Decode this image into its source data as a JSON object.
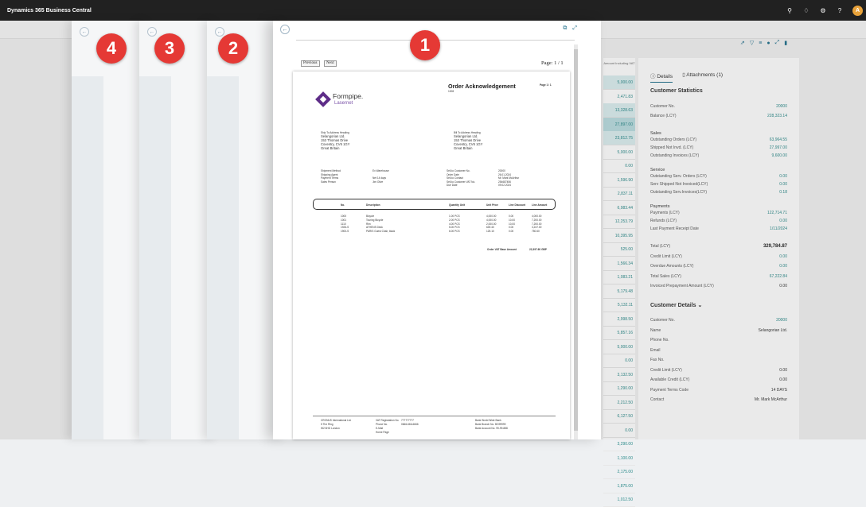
{
  "app": {
    "title": "Dynamics 365 Business Central",
    "avatar": "A"
  },
  "topbar": {
    "icons": [
      "search-icon",
      "bell-icon",
      "gear-icon",
      "help-icon"
    ],
    "icon_glyphs": [
      "⚲",
      "♢",
      "⚙",
      "?"
    ]
  },
  "stack": [
    {
      "num": "4"
    },
    {
      "num": "3"
    },
    {
      "num": "2"
    }
  ],
  "card": {
    "num": "1",
    "nav": {
      "previous": "Previous",
      "next": "Next",
      "page": "Page: 1 / 1"
    },
    "doc": {
      "title": "Order Acknowledgement",
      "number": "1008",
      "page": "Page 1 / 1",
      "logo_name": "Formpipe.",
      "logo_sub": "Lasernet",
      "ship_heading": "Ship To Address Heading",
      "ship_lines": [
        "Selangorian Ltd.",
        "153 Thomas Drive",
        "Coventry, CV6 1GY",
        "Great Britain"
      ],
      "bill_heading": "Bill To Address Heading",
      "bill_lines": [
        "Selangorian Ltd.",
        "153 Thomas Drive",
        "Coventry, CV6 1GY",
        "Great Britain"
      ],
      "left_info": [
        {
          "k": "Shipment Method",
          "v": "Ex Warehouse"
        },
        {
          "k": "Shipping Agent",
          "v": ""
        },
        {
          "k": "Payment Terms",
          "v": "Net 14 days"
        },
        {
          "k": "Sales Person",
          "v": "Jim Olive"
        }
      ],
      "right_info": [
        {
          "k": "Sell-to Customer No.",
          "v": "20000"
        },
        {
          "k": "Order Date",
          "v": "26.01.2024"
        },
        {
          "k": "Sell-to Contact",
          "v": "Mr. Mark McArthur"
        },
        {
          "k": "Sell-to Customer VAT No.",
          "v": "254687456"
        },
        {
          "k": "Due Date",
          "v": "09.02.2024"
        }
      ],
      "cols": [
        "No.",
        "Description",
        "Quantity Unit",
        "Unit Price",
        "Line Discount",
        "Line Amount"
      ],
      "rows": [
        [
          "1000",
          "Bicycle",
          "1.00 PCS",
          "4,000.00",
          "0.00",
          "4,000.00"
        ],
        [
          "1001",
          "Touring Bicycle",
          "2.00 PCS",
          "4,000.00",
          "10.00",
          "7,200.00"
        ],
        [
          "1110",
          "Rim",
          "4.00 PCS",
          "2,000.00",
          "10.00",
          "7,200.00"
        ],
        [
          "1926-S",
          "ATHENS Desk",
          "5.00 PCS",
          "649.40",
          "0.00",
          "3,247.00"
        ],
        [
          "1900-S",
          "PARIS Guest Chair, black",
          "6.00 PCS",
          "125.10",
          "0.00",
          "750.60"
        ]
      ],
      "total_label": "Order VAT Base Amount",
      "total_value": "22,397.60 GBP",
      "footer": {
        "company": [
          "CRONUS International Ltd.",
          "5 The Ring",
          "W2 8HG London"
        ],
        "contact_labels": [
          "VAT Registration No.",
          "Phone No.",
          "E-Mail",
          "Home Page"
        ],
        "contact_values": [
          "777777777",
          "0666-666-6666",
          "",
          ""
        ],
        "bank": [
          "Bank World Wide Bank",
          "Bank Branch No. BG99999",
          "Bank Account No. 99-99-888"
        ]
      }
    }
  },
  "list": {
    "header": "Amount Including VAT",
    "values": [
      "5,000.00",
      "2,471.83",
      "13,328.63",
      "27,897.00",
      "23,812.75",
      "5,000.00",
      "0.00",
      "1,596.90",
      "2,837.11",
      "6,983.44",
      "12,253.79",
      "10,395.95",
      "525.00",
      "1,566.34",
      "1,083.21",
      "5,179.48",
      "5,132.11",
      "2,998.50",
      "5,857.16",
      "5,000.00",
      "0.00",
      "3,132.50",
      "1,290.00",
      "2,212.50",
      "6,127.50",
      "0.00",
      "3,290.00",
      "1,100.00",
      "2,175.00",
      "1,875.00",
      "1,012.50"
    ]
  },
  "factbox": {
    "tabs": [
      "Details",
      "Attachments (1)"
    ],
    "tab_icons": [
      "info-icon",
      "paperclip-icon"
    ],
    "tools": [
      "share-icon",
      "filter-icon",
      "list-icon",
      "info-icon",
      "expand-icon",
      "bookmark-icon"
    ],
    "stats_heading": "Customer Statistics",
    "block1": [
      {
        "k": "Customer No.",
        "v": "20000"
      },
      {
        "k": "Balance (LCY)",
        "v": "228,323.14"
      }
    ],
    "sales_heading": "Sales",
    "sales": [
      {
        "k": "Outstanding Orders (LCY)",
        "v": "63,964.55"
      },
      {
        "k": "Shipped Not Invd. (LCY)",
        "v": "27,997.00"
      },
      {
        "k": "Outstanding Invoices (LCY)",
        "v": "9,600.00"
      }
    ],
    "service_heading": "Service",
    "service": [
      {
        "k": "Outstanding Serv. Orders (LCY)",
        "v": "0.00"
      },
      {
        "k": "Serv Shipped Not Invoiced(LCY)",
        "v": "0.00"
      },
      {
        "k": "Outstanding Serv.Invoices(LCY)",
        "v": "0.18"
      }
    ],
    "payments_heading": "Payments",
    "payments": [
      {
        "k": "Payments (LCY)",
        "v": "122,714.71"
      },
      {
        "k": "Refunds (LCY)",
        "v": "0.00"
      },
      {
        "k": "Last Payment Receipt Date",
        "v": "1/11/2024"
      }
    ],
    "totals": [
      {
        "k": "Total (LCY)",
        "v": "329,784.87"
      },
      {
        "k": "Credit Limit (LCY)",
        "v": "0.00"
      },
      {
        "k": "Overdue Amounts (LCY)",
        "v": "0.00"
      },
      {
        "k": "Total Sales (LCY)",
        "v": "67,222.84"
      },
      {
        "k": "Invoiced Prepayment Amount (LCY)",
        "v": "0.00"
      }
    ],
    "details_heading": "Customer Details",
    "details": [
      {
        "k": "Customer No.",
        "v": "20000"
      },
      {
        "k": "Name",
        "v": "Selangorian Ltd."
      },
      {
        "k": "Phone No.",
        "v": ""
      },
      {
        "k": "Email",
        "v": ""
      },
      {
        "k": "Fax No.",
        "v": ""
      },
      {
        "k": "Credit Limit (LCY)",
        "v": "0.00"
      },
      {
        "k": "Available Credit (LCY)",
        "v": "0.00"
      },
      {
        "k": "Payment Terms Code",
        "v": "14 DAYS"
      },
      {
        "k": "Contact",
        "v": "Mr. Mark McArthur"
      }
    ]
  }
}
